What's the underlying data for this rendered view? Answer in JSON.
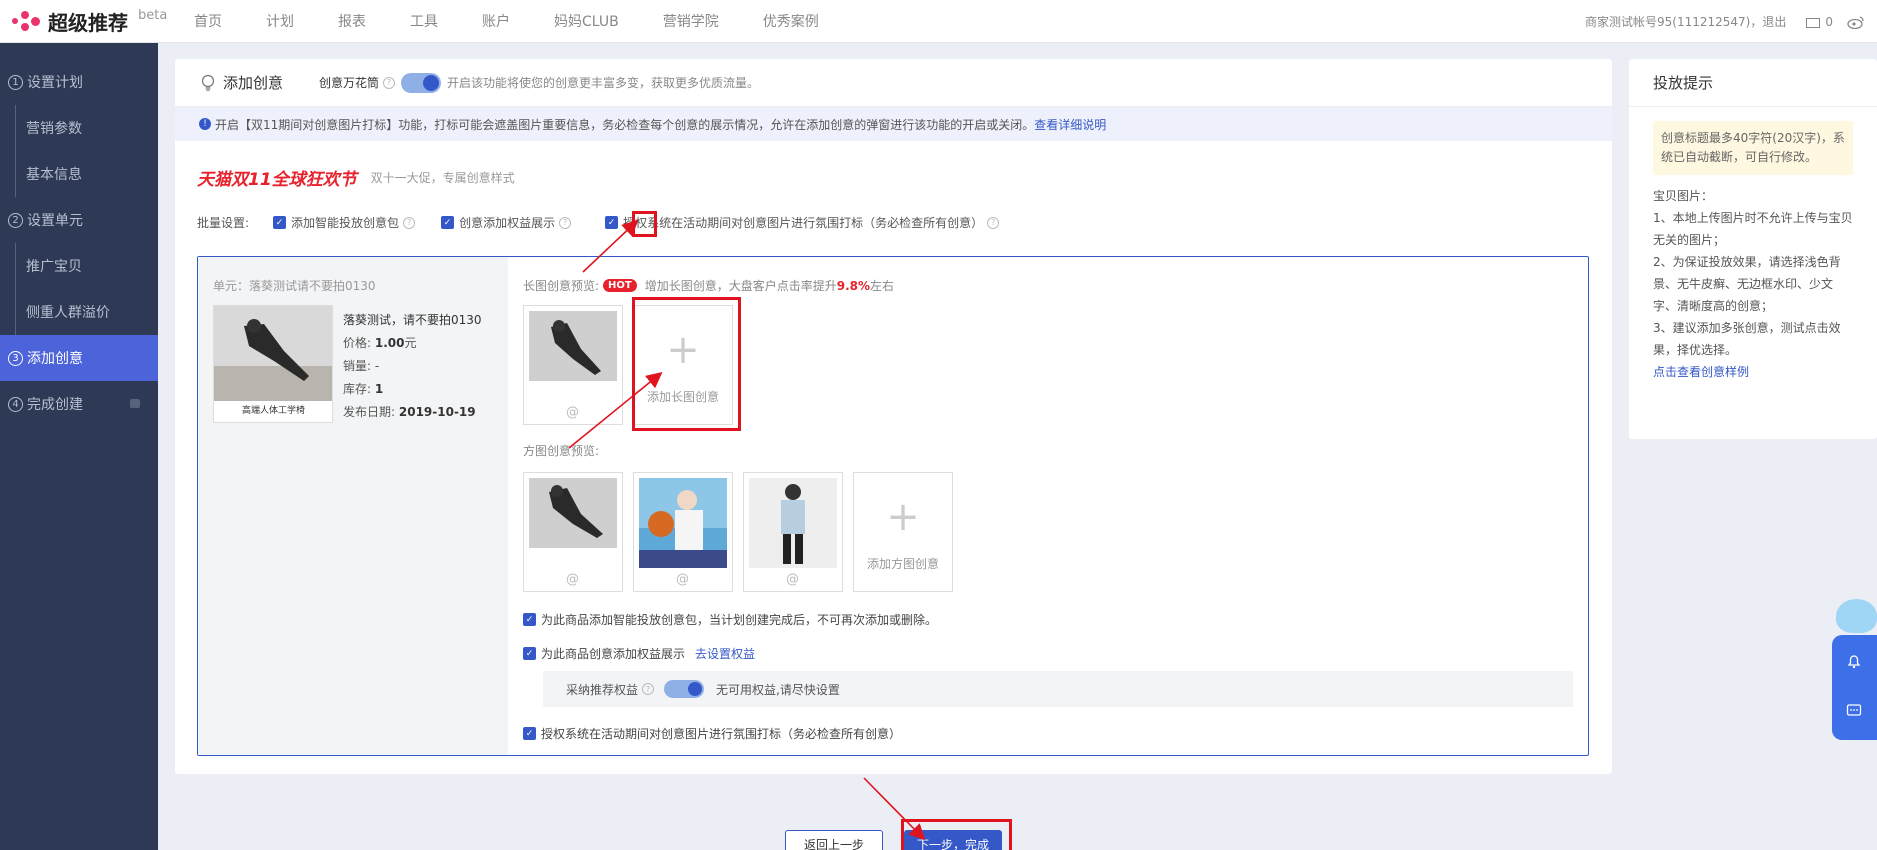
{
  "top": {
    "logo": "超级推荐",
    "beta": "beta",
    "nav": [
      "首页",
      "计划",
      "报表",
      "工具",
      "账户",
      "妈妈CLUB",
      "营销学院",
      "优秀案例"
    ],
    "account": "商家测试帐号95(111212547)，退出",
    "mail_count": "0"
  },
  "sidebar": [
    {
      "num": "1",
      "label": "设置计划",
      "sub": false,
      "active": false
    },
    {
      "num": "",
      "label": "营销参数",
      "sub": true,
      "active": false
    },
    {
      "num": "",
      "label": "基本信息",
      "sub": true,
      "active": false
    },
    {
      "num": "2",
      "label": "设置单元",
      "sub": false,
      "active": false
    },
    {
      "num": "",
      "label": "推广宝贝",
      "sub": true,
      "active": false
    },
    {
      "num": "",
      "label": "侧重人群溢价",
      "sub": true,
      "active": false
    },
    {
      "num": "3",
      "label": "添加创意",
      "sub": false,
      "active": true
    },
    {
      "num": "4",
      "label": "完成创建",
      "sub": false,
      "active": false
    }
  ],
  "card": {
    "title": "添加创意",
    "kali_label": "创意万花筒",
    "kali_desc": "开启该功能将使您的创意更丰富多变，获取更多优质流量。",
    "notice_text": "开启【双11期间对创意图片打标】功能，打标可能会遮盖图片重要信息，务必检查每个创意的展示情况，允许在添加创意的弹窗进行该功能的开启或关闭。",
    "notice_link": "查看详细说明",
    "promo_logo": "天猫双11全球狂欢节",
    "promo_desc": "双十一大促，专属创意样式",
    "batch_label": "批量设置:",
    "batch_items": [
      "添加智能投放创意包",
      "创意添加权益展示",
      "授权系统在活动期间对创意图片进行氛围打标（务必检查所有创意）"
    ]
  },
  "unit": {
    "label": "单元：落葵测试请不要拍0130",
    "product_name": "落葵测试，请不要拍0130",
    "price_label": "价格:",
    "price": "1.00",
    "price_unit": "元",
    "sales_label": "销量:",
    "sales": "-",
    "stock_label": "库存:",
    "stock": "1",
    "date_label": "发布日期:",
    "date": "2019-10-19",
    "img_caption": "高端人体工学椅"
  },
  "creative": {
    "long_label": "长图创意预览:",
    "hot": "HOT",
    "long_desc_pre": "增加长图创意，大盘客户点击率提升",
    "long_pct": "9.8%",
    "long_desc_post": "左右",
    "add_long": "添加长图创意",
    "square_label": "方图创意预览:",
    "add_square": "添加方图创意",
    "opt1": "为此商品添加智能投放创意包，当计划创建完成后，不可再次添加或删除。",
    "opt2": "为此商品创意添加权益展示",
    "opt2_link": "去设置权益",
    "rights_label": "采纳推荐权益",
    "rights_desc": "无可用权益,请尽快设置",
    "opt3": "授权系统在活动期间对创意图片进行氛围打标（务必检查所有创意）"
  },
  "tips": {
    "title": "投放提示",
    "yellow": "创意标题最多40字符(20汉字)，系统已自动截断，可自行修改。",
    "body_title": "宝贝图片：",
    "items": [
      "1、本地上传图片时不允许上传与宝贝无关的图片；",
      "2、为保证投放效果，请选择浅色背景、无牛皮癣、无边框水印、少文字、清晰度高的创意；",
      "3、建议添加多张创意，测试点击效果，择优选择。"
    ],
    "link": "点击查看创意样例"
  },
  "buttons": {
    "back": "返回上一步",
    "next": "下一步，完成"
  },
  "colors": {
    "primary": "#3458c7",
    "sidebar": "#2e3a55",
    "active": "#4d63d9",
    "hot": "#e8222c",
    "annotation": "#e0141e"
  }
}
